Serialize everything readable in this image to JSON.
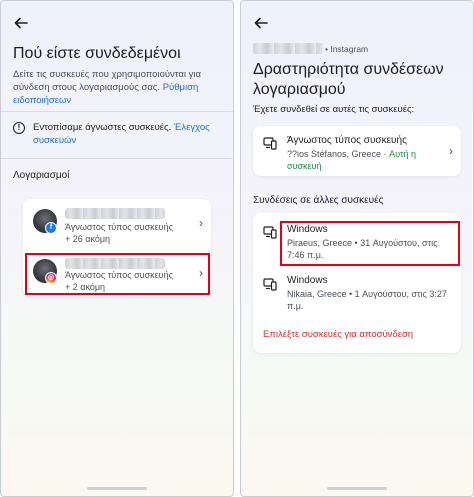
{
  "left": {
    "title": "Πού είστε συνδεδεμένοι",
    "subtitle": "Δείτε τις συσκευές που χρησιμοποιούνται για σύνδεση στους λογαριασμούς σας.",
    "subtitle_link": "Ρύθμιση ειδοποιήσεων",
    "alert_text": "Εντοπίσαμε άγνωστες συσκευές.",
    "alert_link": "Έλεγχος συσκευών",
    "accounts_heading": "Λογαριασμοί",
    "accounts": [
      {
        "platform": "facebook",
        "device": "Άγνωστος τύπος συσκευής",
        "more": "+ 26 ακόμη"
      },
      {
        "platform": "instagram",
        "device": "Άγνωστος τύπος συσκευής",
        "more": "+ 2 ακόμη"
      }
    ]
  },
  "right": {
    "account_label": "• Instagram",
    "title_line1": "Δραστηριότητα συνδέσεων",
    "title_line2": "λογαριασμού",
    "subtitle": "Έχετε συνδεθεί σε αυτές τις συσκευές:",
    "current_device": {
      "name": "Άγνωστος τύπος συσκευής",
      "meta": "??ios Stéfanos, Greece · ",
      "status": "Αυτή η συσκευή"
    },
    "other_heading": "Συνδέσεις σε άλλες συσκευές",
    "other_devices": [
      {
        "name": "Windows",
        "meta": "Piraeus, Greece • 31 Αυγούστου, στις 7:46 π.μ."
      },
      {
        "name": "Windows",
        "meta": "Nikaia, Greece • 1 Αυγούστου, στις 3:27 π.μ."
      }
    ],
    "logout_action": "Επιλέξτε συσκευές για αποσύνδεση"
  },
  "colors": {
    "link": "#1d6ed8",
    "highlight": "#e0001b",
    "danger": "#d62c2c",
    "active": "#1e8e3e"
  }
}
